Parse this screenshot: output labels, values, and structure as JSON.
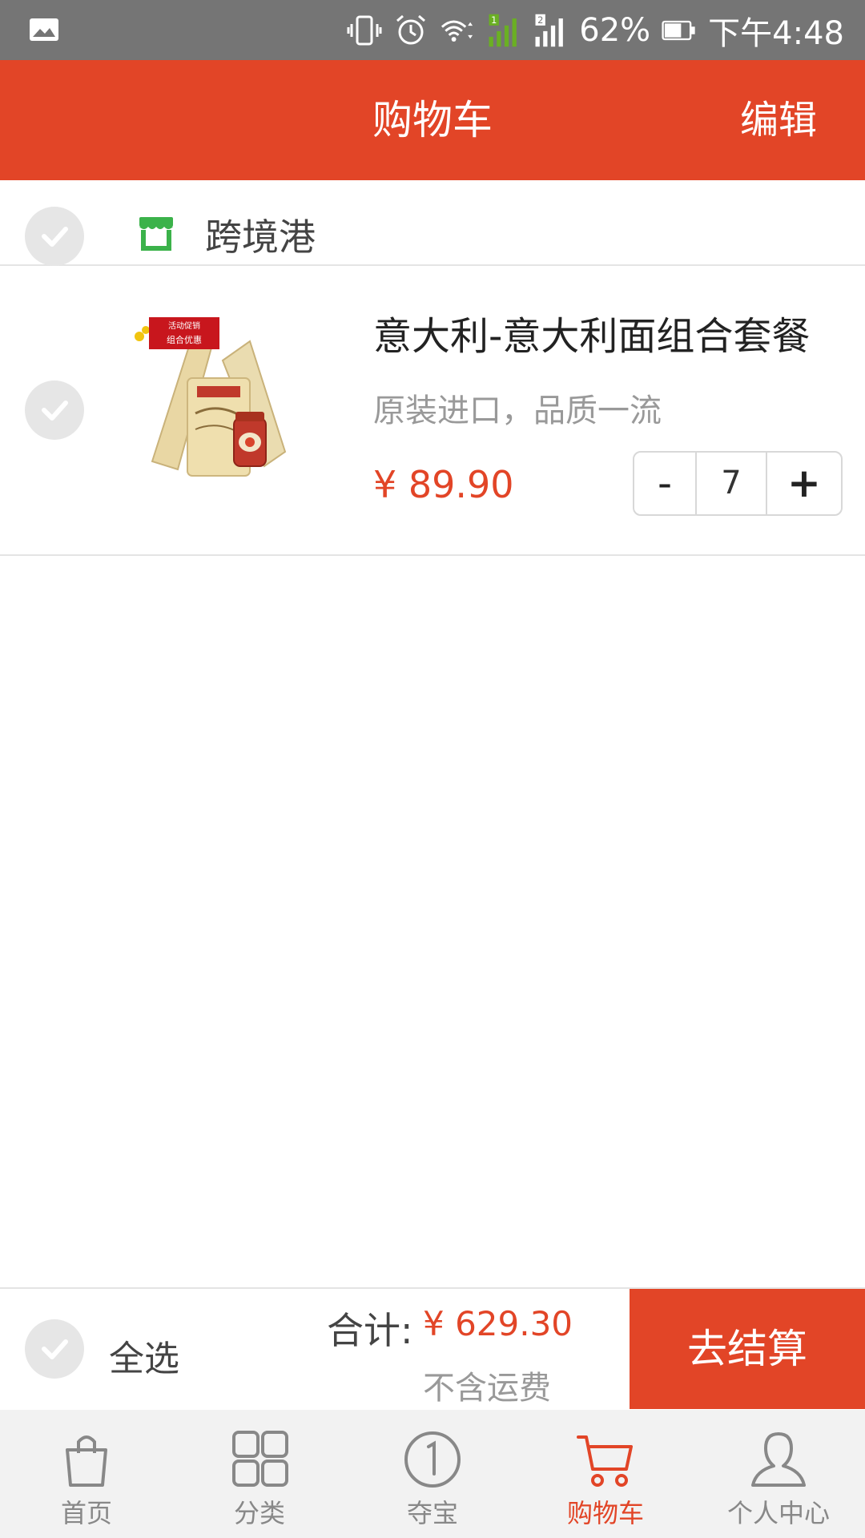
{
  "status_bar": {
    "battery": "62%",
    "time": "下午4:48",
    "icons": [
      "gallery-icon",
      "vibrate-icon",
      "alarm-icon",
      "wifi-icon",
      "signal-sim1-icon",
      "signal-sim2-icon",
      "battery-icon"
    ]
  },
  "header": {
    "title": "购物车",
    "edit_label": "编辑"
  },
  "store": {
    "name": "跨境港",
    "icon": "store-icon"
  },
  "cart_items": [
    {
      "title": "意大利-意大利面组合套餐",
      "description": "原装进口，品质一流",
      "price": "¥ 89.90",
      "quantity": "7",
      "minus_label": "-",
      "plus_label": "+",
      "promo_tag_line1": "活动促销",
      "promo_tag_line2": "组合优惠"
    }
  ],
  "checkout": {
    "select_all_label": "全选",
    "total_label": "合计:",
    "total_value": "¥ 629.30",
    "shipping_note": "不含运费",
    "checkout_label": "去结算"
  },
  "tabs": [
    {
      "label": "首页",
      "icon": "bag-icon",
      "active": false
    },
    {
      "label": "分类",
      "icon": "grid-icon",
      "active": false
    },
    {
      "label": "夺宝",
      "icon": "treasure-icon",
      "active": false
    },
    {
      "label": "购物车",
      "icon": "cart-icon",
      "active": true
    },
    {
      "label": "个人中心",
      "icon": "user-icon",
      "active": false
    }
  ],
  "colors": {
    "accent": "#e24527",
    "status_bar": "#757575",
    "store_icon": "#3bb24a"
  }
}
